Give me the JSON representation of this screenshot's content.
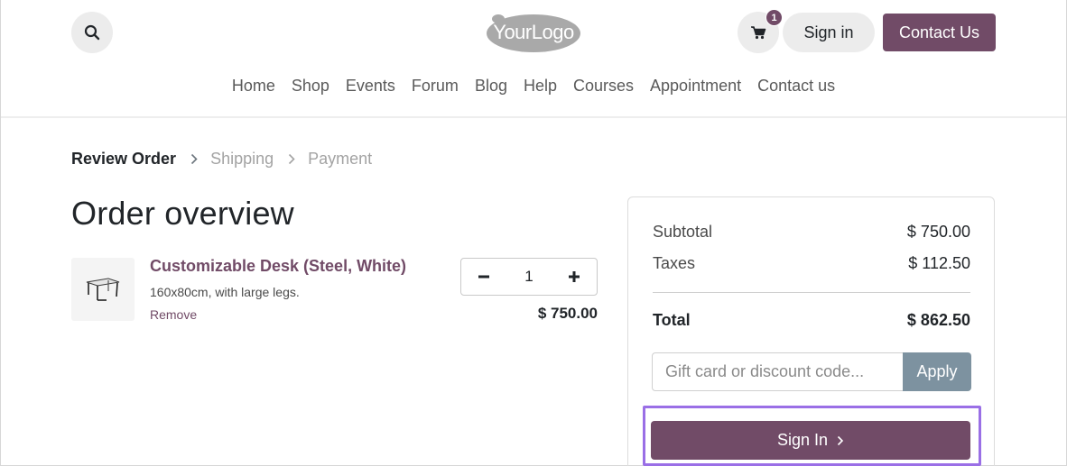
{
  "colors": {
    "brand": "#714b67",
    "apply_button": "#7d92a0",
    "highlight_outline": "#9a6fe6",
    "pill_bg": "#ececec"
  },
  "header": {
    "search_icon": "search-icon",
    "logo_text": "YourLogo",
    "cart_icon": "cart-icon",
    "cart_count": "1",
    "signin_label": "Sign in",
    "contact_label": "Contact Us"
  },
  "nav": {
    "items": [
      "Home",
      "Shop",
      "Events",
      "Forum",
      "Blog",
      "Help",
      "Courses",
      "Appointment",
      "Contact us"
    ]
  },
  "steps": {
    "current": "Review Order",
    "next": "Shipping",
    "last": "Payment",
    "separator_icon": "chevron-right-icon"
  },
  "order": {
    "title": "Order overview",
    "product": {
      "name": "Customizable Desk (Steel, White)",
      "description": "160x80cm, with large legs.",
      "remove_label": "Remove",
      "quantity": "1",
      "price": "$ 750.00",
      "image_icon": "desk-icon"
    }
  },
  "summary": {
    "subtotal_label": "Subtotal",
    "subtotal_value": "$ 750.00",
    "taxes_label": "Taxes",
    "taxes_value": "$ 112.50",
    "total_label": "Total",
    "total_value": "$ 862.50",
    "promo_placeholder": "Gift card or discount code...",
    "apply_label": "Apply",
    "checkout_label": "Sign In",
    "checkout_icon": "chevron-right-icon"
  }
}
